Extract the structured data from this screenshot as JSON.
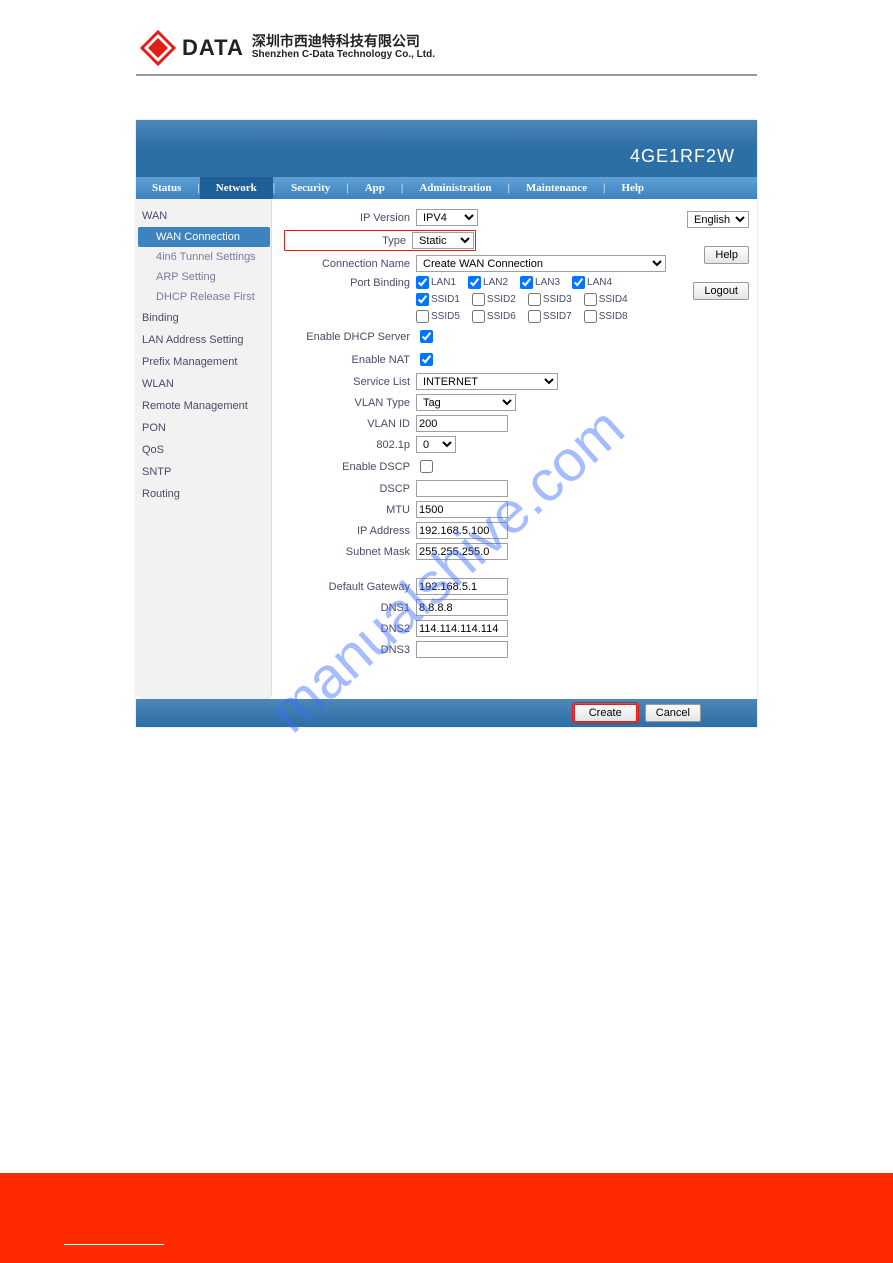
{
  "company": {
    "cn": "深圳市西迪特科技有限公司",
    "en": "Shenzhen C-Data Technology Co., Ltd.",
    "logo_text": "DATA"
  },
  "model": "4GE1RF2W",
  "watermark": "manualshive.com",
  "nav": [
    "Status",
    "Network",
    "Security",
    "App",
    "Administration",
    "Maintenance",
    "Help"
  ],
  "nav_active": 1,
  "sidebar": {
    "groups": [
      {
        "label": "WAN",
        "items": [
          "WAN Connection",
          "4in6 Tunnel Settings",
          "ARP Setting",
          "DHCP Release First"
        ],
        "active": 0
      },
      {
        "label": "Binding"
      },
      {
        "label": "LAN Address Setting"
      },
      {
        "label": "Prefix Management"
      },
      {
        "label": "WLAN"
      },
      {
        "label": "Remote Management"
      },
      {
        "label": "PON"
      },
      {
        "label": "QoS"
      },
      {
        "label": "SNTP"
      },
      {
        "label": "Routing"
      }
    ]
  },
  "right": {
    "lang": "English",
    "help": "Help",
    "logout": "Logout"
  },
  "form": {
    "ip_version": {
      "label": "IP Version",
      "value": "IPV4"
    },
    "type": {
      "label": "Type",
      "value": "Static"
    },
    "conn_name": {
      "label": "Connection Name",
      "value": "Create WAN Connection"
    },
    "port_binding": {
      "label": "Port Binding",
      "row1": [
        {
          "l": "LAN1",
          "c": true
        },
        {
          "l": "LAN2",
          "c": true
        },
        {
          "l": "LAN3",
          "c": true
        },
        {
          "l": "LAN4",
          "c": true
        }
      ],
      "row2": [
        {
          "l": "SSID1",
          "c": true
        },
        {
          "l": "SSID2",
          "c": false
        },
        {
          "l": "SSID3",
          "c": false
        },
        {
          "l": "SSID4",
          "c": false
        }
      ],
      "row3": [
        {
          "l": "SSID5",
          "c": false
        },
        {
          "l": "SSID6",
          "c": false
        },
        {
          "l": "SSID7",
          "c": false
        },
        {
          "l": "SSID8",
          "c": false
        }
      ]
    },
    "dhcp": {
      "label": "Enable DHCP Server",
      "c": true
    },
    "nat": {
      "label": "Enable NAT",
      "c": true
    },
    "service": {
      "label": "Service List",
      "value": "INTERNET"
    },
    "vlan_type": {
      "label": "VLAN Type",
      "value": "Tag"
    },
    "vlan_id": {
      "label": "VLAN ID",
      "value": "200"
    },
    "p8021": {
      "label": "802.1p",
      "value": "0"
    },
    "enable_dscp": {
      "label": "Enable DSCP",
      "c": false
    },
    "dscp": {
      "label": "DSCP",
      "value": ""
    },
    "mtu": {
      "label": "MTU",
      "value": "1500"
    },
    "ip": {
      "label": "IP Address",
      "value": "192.168.5.100"
    },
    "mask": {
      "label": "Subnet Mask",
      "value": "255.255.255.0"
    },
    "gw": {
      "label": "Default Gateway",
      "value": "192.168.5.1"
    },
    "dns1": {
      "label": "DNS1",
      "value": "8.8.8.8"
    },
    "dns2": {
      "label": "DNS2",
      "value": "114.114.114.114"
    },
    "dns3": {
      "label": "DNS3",
      "value": ""
    }
  },
  "buttons": {
    "create": "Create",
    "cancel": "Cancel"
  }
}
